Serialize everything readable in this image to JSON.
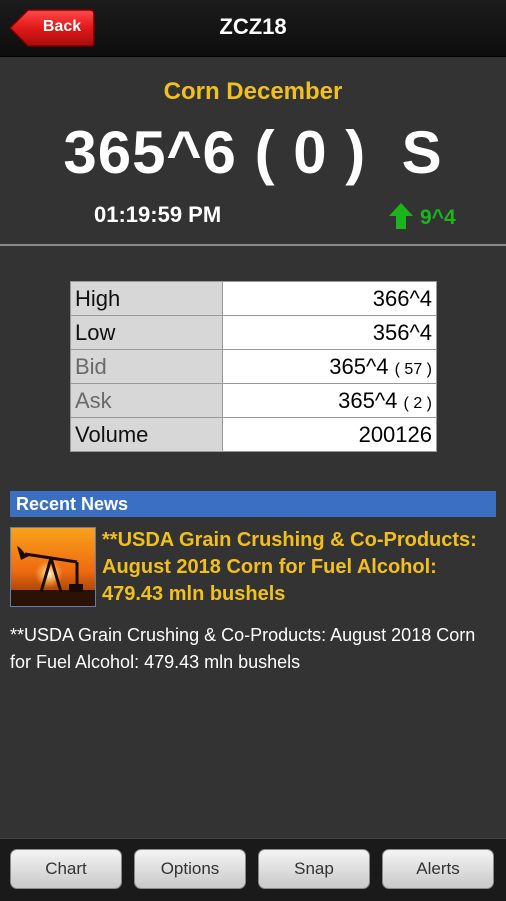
{
  "header": {
    "back_label": "Back",
    "title": "ZCZ18"
  },
  "quote": {
    "name": "Corn December",
    "price_line": "365^6 ( 0 )  S",
    "time": "01:19:59 PM",
    "change": "9^4",
    "change_direction": "up",
    "change_color": "#1bb51b"
  },
  "stats": [
    {
      "label": "High",
      "value": "366^4",
      "size": ""
    },
    {
      "label": "Low",
      "value": "356^4",
      "size": ""
    },
    {
      "label": "Bid",
      "value": "365^4",
      "size": "( 57 )"
    },
    {
      "label": "Ask",
      "value": "365^4",
      "size": "( 2 )"
    },
    {
      "label": "Volume",
      "value": "200126",
      "size": ""
    }
  ],
  "news": {
    "section_title": "Recent News",
    "thumbnail_icon": "oil-pump-sunset-thumbnail",
    "headline": "**USDA Grain Crushing & Co-Products: August 2018 Corn for Fuel Alcohol: 479.43 mln bushels",
    "body": "**USDA Grain Crushing & Co-Products: August 2018 Corn for Fuel Alcohol: 479.43 mln bushels"
  },
  "toolbar": {
    "chart_label": "Chart",
    "options_label": "Options",
    "snap_label": "Snap",
    "alerts_label": "Alerts"
  },
  "colors": {
    "accent": "#f2c01c",
    "back_button": "#d9121b",
    "news_header": "#3a6fc4",
    "background": "#333333"
  }
}
